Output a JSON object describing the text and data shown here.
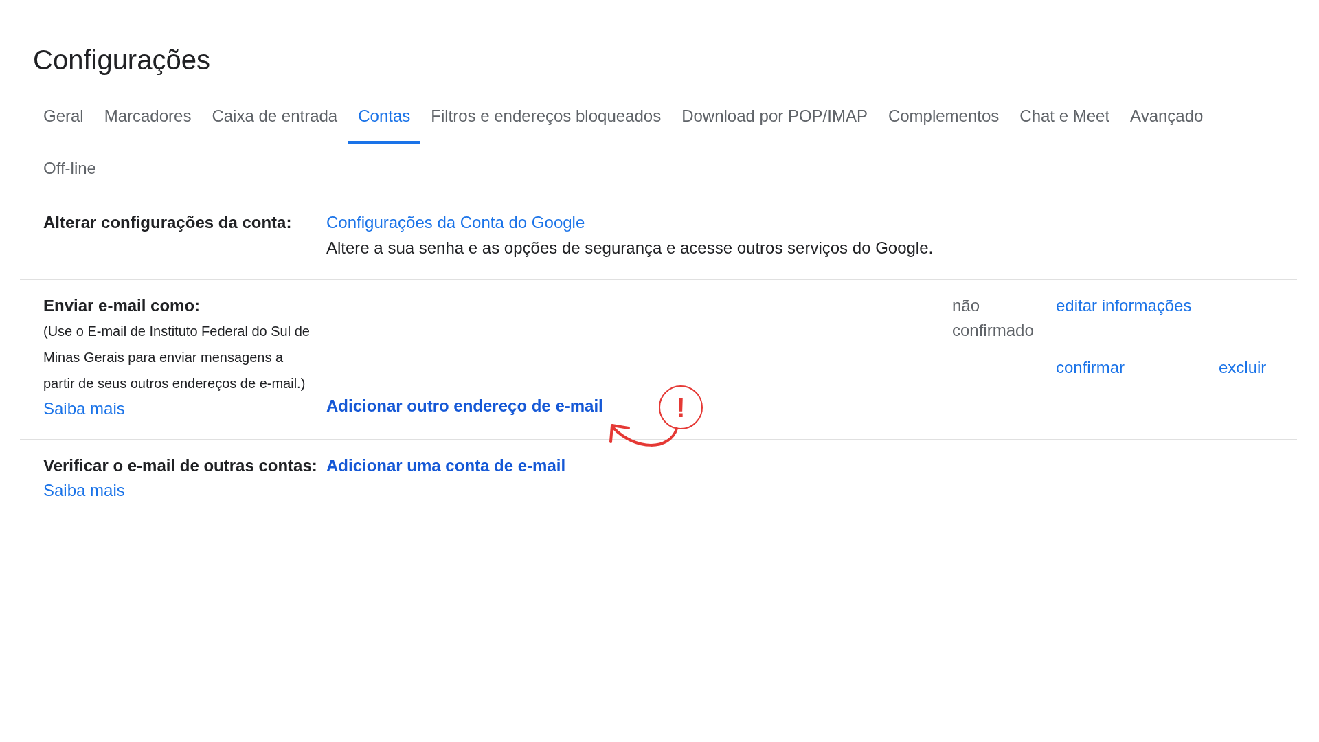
{
  "title": "Configurações",
  "tabs": [
    {
      "label": "Geral",
      "selected": false
    },
    {
      "label": "Marcadores",
      "selected": false
    },
    {
      "label": "Caixa de entrada",
      "selected": false
    },
    {
      "label": "Contas",
      "selected": true
    },
    {
      "label": "Filtros e endereços bloqueados",
      "selected": false
    },
    {
      "label": "Download por POP/IMAP",
      "selected": false
    },
    {
      "label": "Complementos",
      "selected": false
    },
    {
      "label": "Chat e Meet",
      "selected": false
    },
    {
      "label": "Avançado",
      "selected": false
    },
    {
      "label": "Off-line",
      "selected": false
    }
  ],
  "account_settings": {
    "label": "Alterar configurações da conta:",
    "link": "Configurações da Conta do Google",
    "description": "Altere a sua senha e as opções de segurança e acesse outros serviços do Google."
  },
  "send_as": {
    "label": "Enviar e-mail como:",
    "description": "(Use o E-mail de Instituto Federal do Sul de Minas Gerais para enviar mensagens a partir de seus outros endereços de e-mail.)",
    "learn_more": "Saiba mais",
    "edit_link": "editar informações",
    "status": "não confirmado",
    "confirm_link": "confirmar",
    "delete_link": "excluir",
    "add_link": "Adicionar outro endereço de e-mail"
  },
  "check_mail": {
    "label": "Verificar o e-mail de outras contas:",
    "learn_more": "Saiba mais",
    "add_link": "Adicionar uma conta de e-mail"
  },
  "annotation": {
    "mark": "!"
  }
}
